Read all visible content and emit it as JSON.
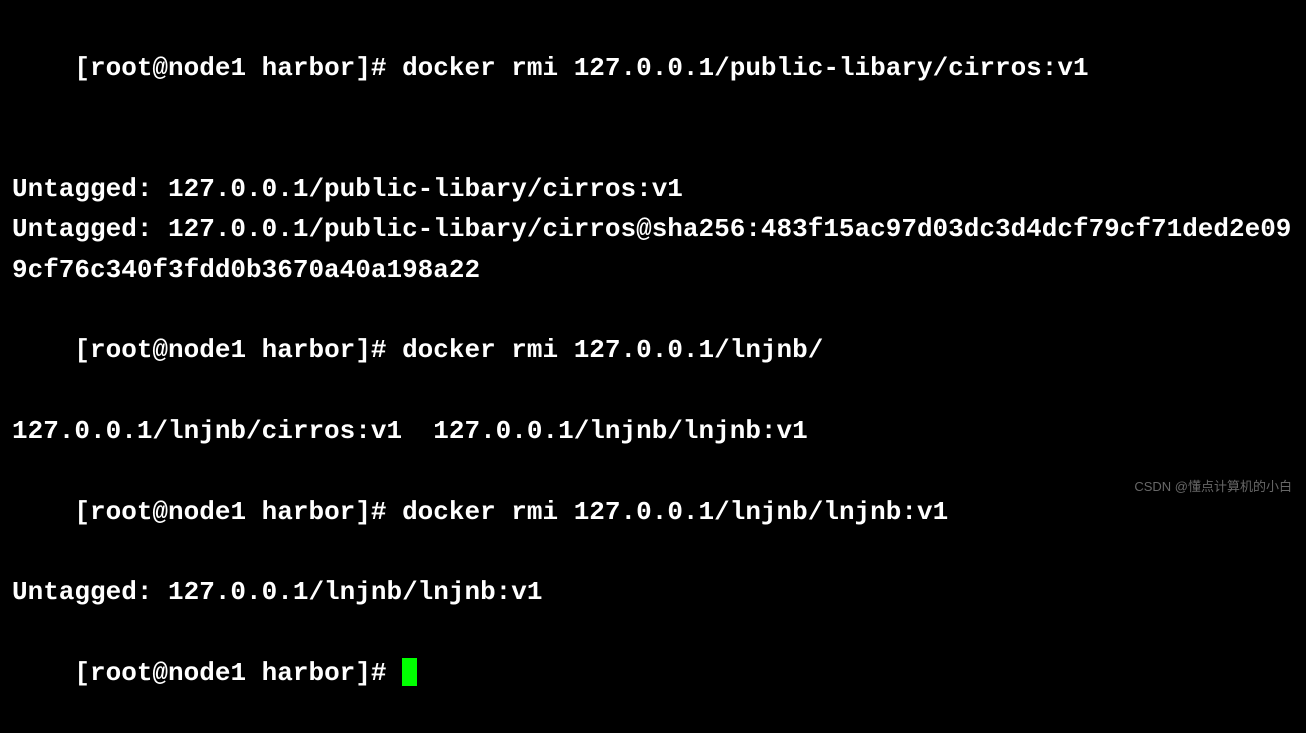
{
  "lines": {
    "l1_prompt": "[root@node1 harbor]# ",
    "l1_cmd": "docker rmi 127.0.0.1/public-libary/cirros:v1",
    "l3": "Untagged: 127.0.0.1/public-libary/cirros:v1",
    "l4": "Untagged: 127.0.0.1/public-libary/cirros@sha256:483f15ac97d03dc3d4dcf79cf71ded2e099cf76c340f3fdd0b3670a40a198a22",
    "l6_prompt": "[root@node1 harbor]# ",
    "l6_cmd": "docker rmi 127.0.0.1/lnjnb/",
    "l7": "127.0.0.1/lnjnb/cirros:v1  127.0.0.1/lnjnb/lnjnb:v1",
    "l8_prompt": "[root@node1 harbor]# ",
    "l8_cmd": "docker rmi 127.0.0.1/lnjnb/lnjnb:v1",
    "l9": "Untagged: 127.0.0.1/lnjnb/lnjnb:v1",
    "l10_prompt": "[root@node1 harbor]# "
  },
  "watermark": "CSDN @懂点计算机的小白"
}
